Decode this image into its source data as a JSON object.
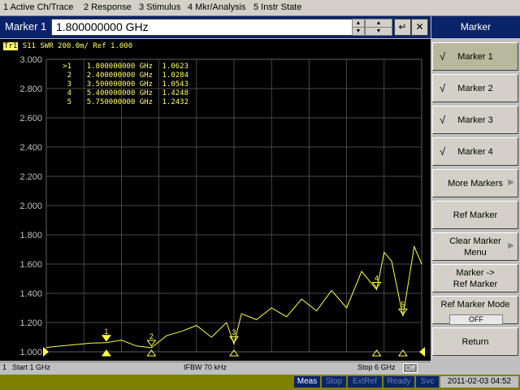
{
  "menu": [
    "1 Active Ch/Trace",
    "2 Response",
    "3 Stimulus",
    "4 Mkr/Analysis",
    "5 Instr State"
  ],
  "entry": {
    "label": "Marker 1",
    "value": "1.800000000 GHz"
  },
  "trace_header": {
    "tag": "Tr1",
    "text": "S11  SWR 200.0m/ Ref 1.000"
  },
  "markers_table": [
    {
      "id": ">1",
      "freq": "1.800000000 GHz",
      "value": "1.0623"
    },
    {
      "id": "2",
      "freq": "2.400000000 GHz",
      "value": "1.0284"
    },
    {
      "id": "3",
      "freq": "3.500000000 GHz",
      "value": "1.0543"
    },
    {
      "id": "4",
      "freq": "5.400000000 GHz",
      "value": "1.4248"
    },
    {
      "id": "5",
      "freq": "5.750000000 GHz",
      "value": "1.2432"
    }
  ],
  "chart_data": {
    "type": "line",
    "title": "",
    "xlabel": "",
    "ylabel": "",
    "xlim": [
      1,
      6
    ],
    "ylim": [
      1.0,
      3.0
    ],
    "yticks": [
      "3.000",
      "2.800",
      "2.600",
      "2.400",
      "2.200",
      "2.000",
      "1.800",
      "1.600",
      "1.400",
      "1.200",
      "1.000"
    ],
    "grid": true,
    "series": [
      {
        "color": "#ffff44",
        "x": [
          1.0,
          1.2,
          1.4,
          1.6,
          1.8,
          2.0,
          2.2,
          2.4,
          2.6,
          2.8,
          3.0,
          3.2,
          3.4,
          3.5,
          3.6,
          3.8,
          4.0,
          4.2,
          4.4,
          4.6,
          4.8,
          5.0,
          5.2,
          5.4,
          5.5,
          5.6,
          5.75,
          5.9,
          6.0
        ],
        "y": [
          1.03,
          1.04,
          1.05,
          1.06,
          1.062,
          1.08,
          1.04,
          1.028,
          1.11,
          1.14,
          1.18,
          1.1,
          1.2,
          1.054,
          1.26,
          1.22,
          1.3,
          1.24,
          1.36,
          1.28,
          1.42,
          1.3,
          1.55,
          1.425,
          1.68,
          1.62,
          1.243,
          1.72,
          1.6
        ]
      }
    ],
    "markers": [
      {
        "id": "1",
        "x": 1.8,
        "y": 1.0623
      },
      {
        "id": "2",
        "x": 2.4,
        "y": 1.0284
      },
      {
        "id": "3",
        "x": 3.5,
        "y": 1.0543
      },
      {
        "id": "4",
        "x": 5.4,
        "y": 1.4248
      },
      {
        "id": "5",
        "x": 5.75,
        "y": 1.2432
      }
    ]
  },
  "status": {
    "start": "Start 1 GHz",
    "ifbw": "IFBW 70 kHz",
    "stop": "Stop 6 GHz",
    "off_label": "Off",
    "channel": "1"
  },
  "bottom": {
    "meas": "Meas",
    "stop": "Stop",
    "extref": "ExtRef",
    "ready": "Ready",
    "svc": "Svc",
    "datetime": "2011-02-03 04:52"
  },
  "softkeys": {
    "title": "Marker",
    "keys": [
      "Marker 1",
      "Marker 2",
      "Marker 3",
      "Marker 4",
      "More Markers",
      "Ref Marker",
      "Clear Marker",
      "Menu",
      "Marker ->",
      "Ref Marker",
      "Ref Marker Mode",
      "OFF",
      "Return"
    ]
  }
}
